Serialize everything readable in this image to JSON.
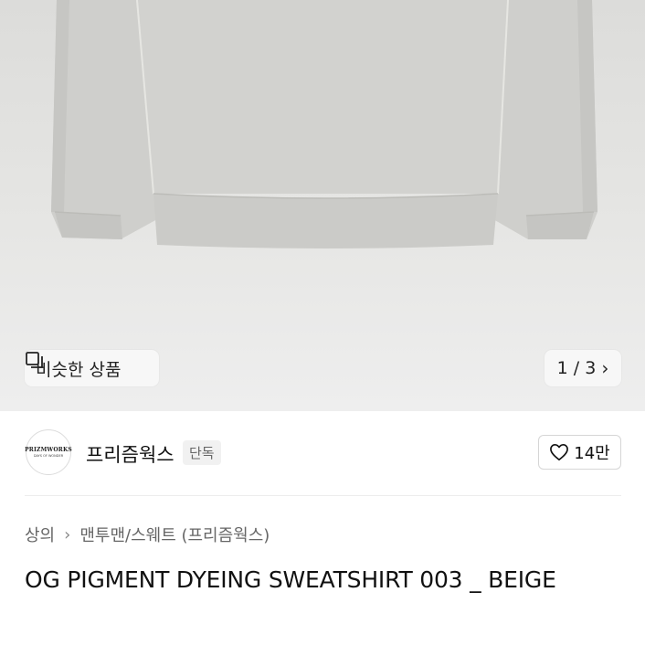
{
  "gallery": {
    "similar_label": "비슷한 상품",
    "similar_icon": "similar-products-icon",
    "pager_text": "1 / 3",
    "pager_icon": "chevron-right-icon",
    "image_background": "#e4e4e2"
  },
  "brand": {
    "name": "프리즘웍스",
    "tag": "단독",
    "logo_text": "PRIZMWORKS",
    "logo_subtext": "DAYS OF WONDER",
    "likes": "14만",
    "like_icon": "heart-outline-icon"
  },
  "breadcrumb": {
    "items": [
      "상의",
      "맨투맨/스웨트 (프리즘웍스)"
    ],
    "separator_icon": "chevron-right-icon"
  },
  "product": {
    "title": "OG PIGMENT DYEING SWEATSHIRT 003 _ BEIGE"
  }
}
